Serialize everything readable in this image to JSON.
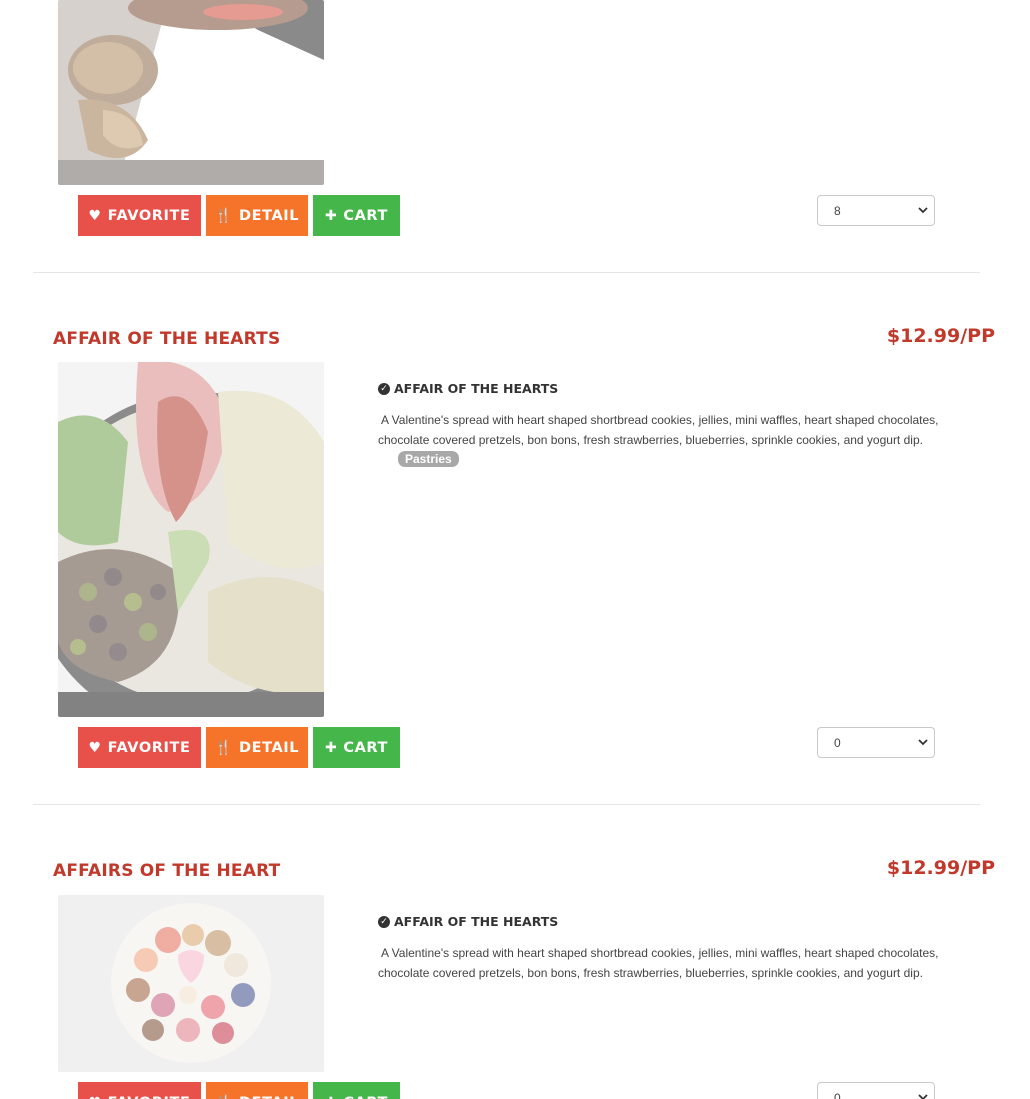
{
  "colors": {
    "title": "#c0392b",
    "favorite": "#e8504a",
    "detail": "#f6732a",
    "cart": "#45b649",
    "tag": "#a8a8a8"
  },
  "buttons": {
    "favorite": "FAVORITE",
    "detail": "DETAIL",
    "cart": "CART"
  },
  "products": [
    {
      "quantity": "8"
    },
    {
      "title": "AFFAIR OF THE HEARTS",
      "price": "$12.99/PP",
      "desc_heading": "AFFAIR OF THE HEARTS",
      "description": "A Valentine's spread with heart shaped shortbread cookies, jellies, mini waffles, heart shaped chocolates, chocolate covered pretzels, bon bons, fresh strawberries, blueberries, sprinkle cookies, and yogurt dip.",
      "tag": "Pastries",
      "quantity": "0"
    },
    {
      "title": "AFFAIRS OF THE HEART",
      "price": "$12.99/PP",
      "desc_heading": "AFFAIR OF THE HEARTS",
      "description": "A Valentine's spread with heart shaped shortbread cookies, jellies, mini waffles, heart shaped chocolates, chocolate covered pretzels, bon bons, fresh strawberries, blueberries, sprinkle cookies, and yogurt dip.",
      "quantity": "0"
    }
  ]
}
